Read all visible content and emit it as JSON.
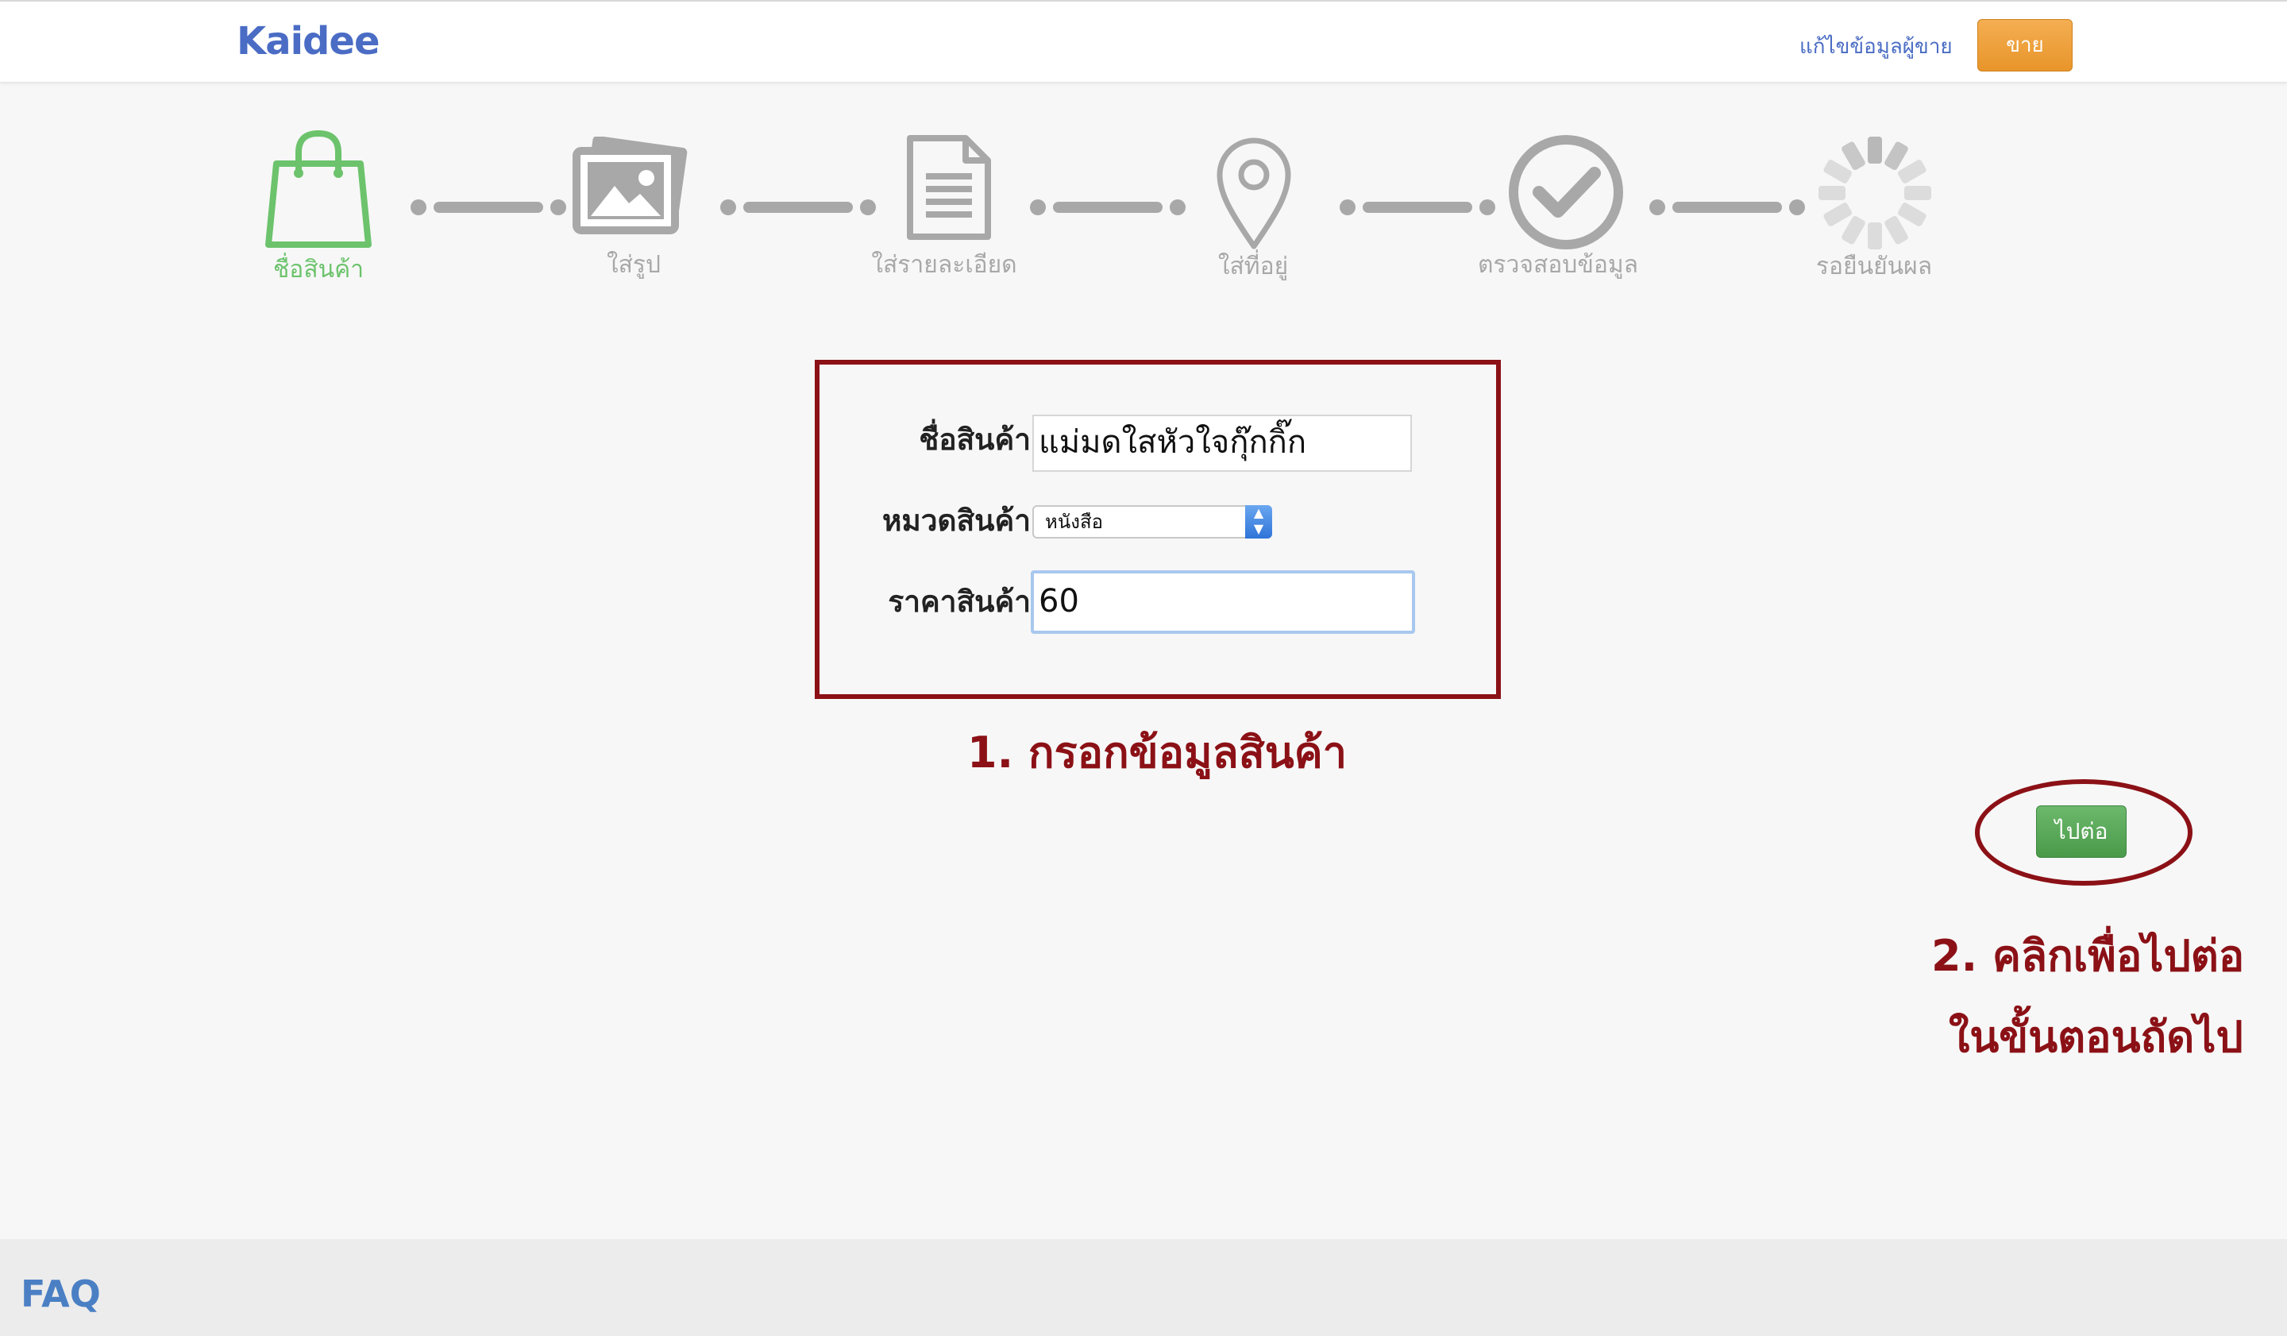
{
  "header": {
    "logo": "Kaidee",
    "edit_seller_link": "แก้ไขข้อมูลผู้ขาย",
    "sell_button": "ขาย"
  },
  "steps": [
    {
      "label": "ชื่อสินค้า",
      "icon": "shopping-bag-icon",
      "state": "active"
    },
    {
      "label": "ใส่รูป",
      "icon": "photos-icon",
      "state": "inactive"
    },
    {
      "label": "ใส่รายละเอียด",
      "icon": "document-icon",
      "state": "inactive"
    },
    {
      "label": "ใส่ที่อยู่",
      "icon": "map-pin-icon",
      "state": "inactive"
    },
    {
      "label": "ตรวจสอบข้อมูล",
      "icon": "check-circle-icon",
      "state": "inactive"
    },
    {
      "label": "รอยืนยันผล",
      "icon": "loading-spinner-icon",
      "state": "inactive"
    }
  ],
  "form": {
    "name_label": "ชื่อสินค้า",
    "name_value": "แม่มดใสหัวใจกุ๊กกิ๊ก",
    "category_label": "หมวดสินค้า",
    "category_value": "หนังสือ",
    "price_label": "ราคาสินค้า",
    "price_value": "60"
  },
  "annotations": {
    "fill_info": "1. กรอกข้อมูลสินค้า",
    "click_next_line1": "2. คลิกเพื่อไปต่อ",
    "click_next_line2": "ในขั้นตอนถัดไป"
  },
  "next_button": "ไปต่อ",
  "footer": {
    "faq": "FAQ"
  },
  "colors": {
    "brand": "#4a6cc4",
    "sell_orange": "#e8952a",
    "active_step": "#6cc36c",
    "inactive_step": "#a8a8a8",
    "annotation_red": "#8b1116",
    "next_green": "#4a9a4a"
  }
}
